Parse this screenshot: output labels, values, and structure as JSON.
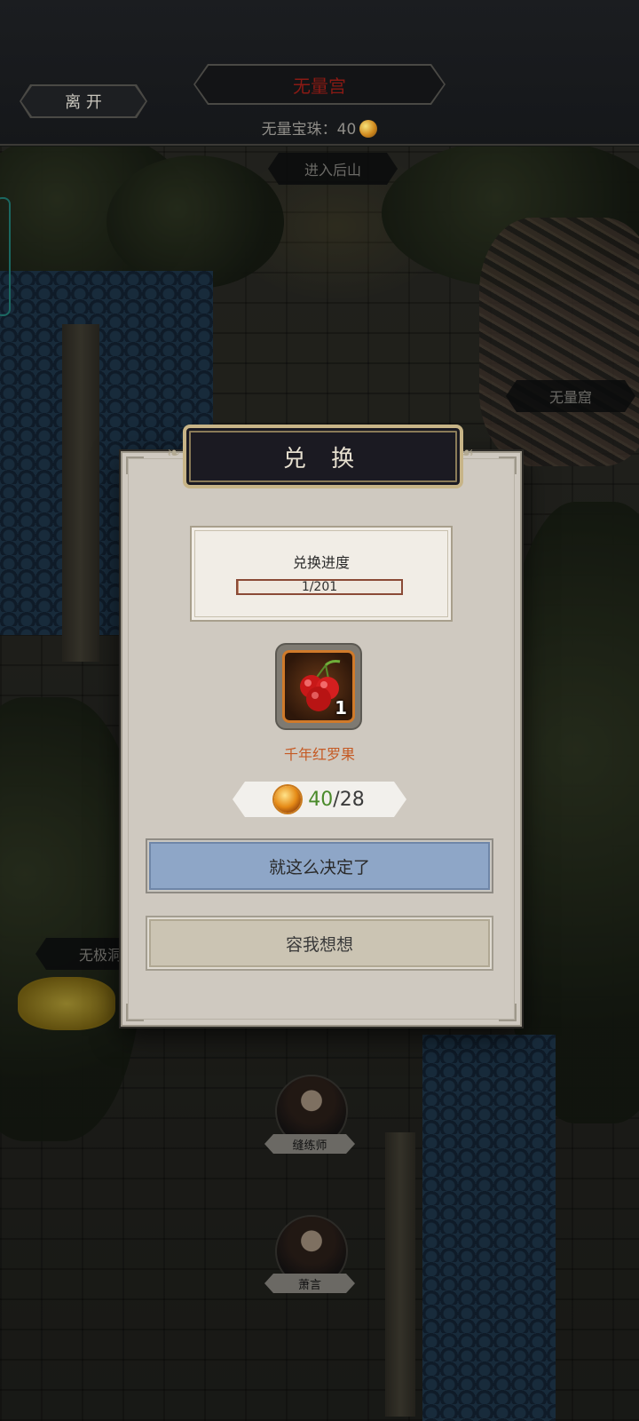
{
  "top_bar": {
    "leave_label": "离 开",
    "location_title": "无量宫",
    "currency_label": "无量宝珠：",
    "currency_value": "40",
    "currency_icon": "gold-orb-icon"
  },
  "map": {
    "labels": {
      "back_mountain": "进入后山",
      "wuliang_cave": "无量窟",
      "wuji_cave": "无极洞"
    },
    "npcs": [
      {
        "name": "缝练师"
      },
      {
        "name": "萧言"
      }
    ]
  },
  "dialog": {
    "title": "兑 换",
    "progress_title": "兑换进度",
    "progress_text": "1/201",
    "progress_fraction": 0.005,
    "item": {
      "icon": "red-fruit-icon",
      "count": "1",
      "name": "千年红罗果"
    },
    "cost": {
      "have": "40",
      "need": "/28",
      "icon": "gold-orb-icon"
    },
    "confirm_label": "就这么决定了",
    "cancel_label": "容我想想"
  },
  "colors": {
    "title_red": "#8a1a14",
    "item_name": "#c55a24",
    "cost_have": "#4a8a2a",
    "confirm_bg": "#8ea6c7",
    "cancel_bg": "#cbc4b3"
  }
}
